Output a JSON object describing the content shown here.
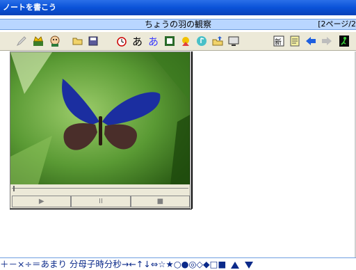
{
  "window": {
    "title": "ノートを書こう"
  },
  "note": {
    "title": "ちょうの羽の観察",
    "page_indicator": "[2ページ/2"
  },
  "toolbar": {
    "buttons": [
      {
        "icon": "pencil-icon"
      },
      {
        "icon": "crown-face-icon"
      },
      {
        "icon": "character-face-icon"
      },
      {
        "icon": "open-folder-icon"
      },
      {
        "icon": "save-disk-icon"
      },
      {
        "icon": "timer-icon"
      },
      {
        "icon": "hiragana-a-black-icon"
      },
      {
        "icon": "hiragana-a-color-icon"
      },
      {
        "icon": "frame-icon"
      },
      {
        "icon": "clipart-icon"
      },
      {
        "icon": "music-icon"
      },
      {
        "icon": "folder-upload-icon"
      },
      {
        "icon": "screen-icon"
      },
      {
        "icon": "new-page-icon"
      },
      {
        "icon": "notepad-icon"
      },
      {
        "icon": "back-arrow-icon"
      },
      {
        "icon": "forward-arrow-icon"
      },
      {
        "icon": "exit-icon"
      }
    ],
    "new_label": "新"
  },
  "media": {
    "play_symbol": "▶",
    "pause_symbol": "II",
    "stop_symbol": "■"
  },
  "symbols": {
    "text": "＋－×÷＝あまり 分母子時分秒→←↑↓⇔☆★○●◎◇◆□■"
  },
  "colors": {
    "accent": "#0a52d8",
    "note_bar": "#b9d6ff",
    "symbol_text": "#0b2a8a"
  }
}
